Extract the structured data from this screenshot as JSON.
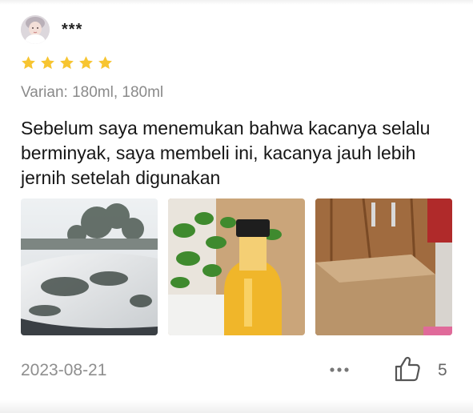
{
  "review": {
    "username": "***",
    "rating": 5,
    "variant": "Varian: 180ml, 180ml",
    "text": "Sebelum saya menemukan bahwa kacanya selalu berminyak, saya membeli ini, kacanya jauh lebih jernih setelah digunakan",
    "date": "2023-08-21",
    "like_count": "5"
  },
  "icons": {
    "star": "star-icon",
    "more": "more-dots-icon",
    "like": "thumbs-up-icon"
  },
  "colors": {
    "star": "#f7c531",
    "muted_text": "#8e8e8e"
  }
}
